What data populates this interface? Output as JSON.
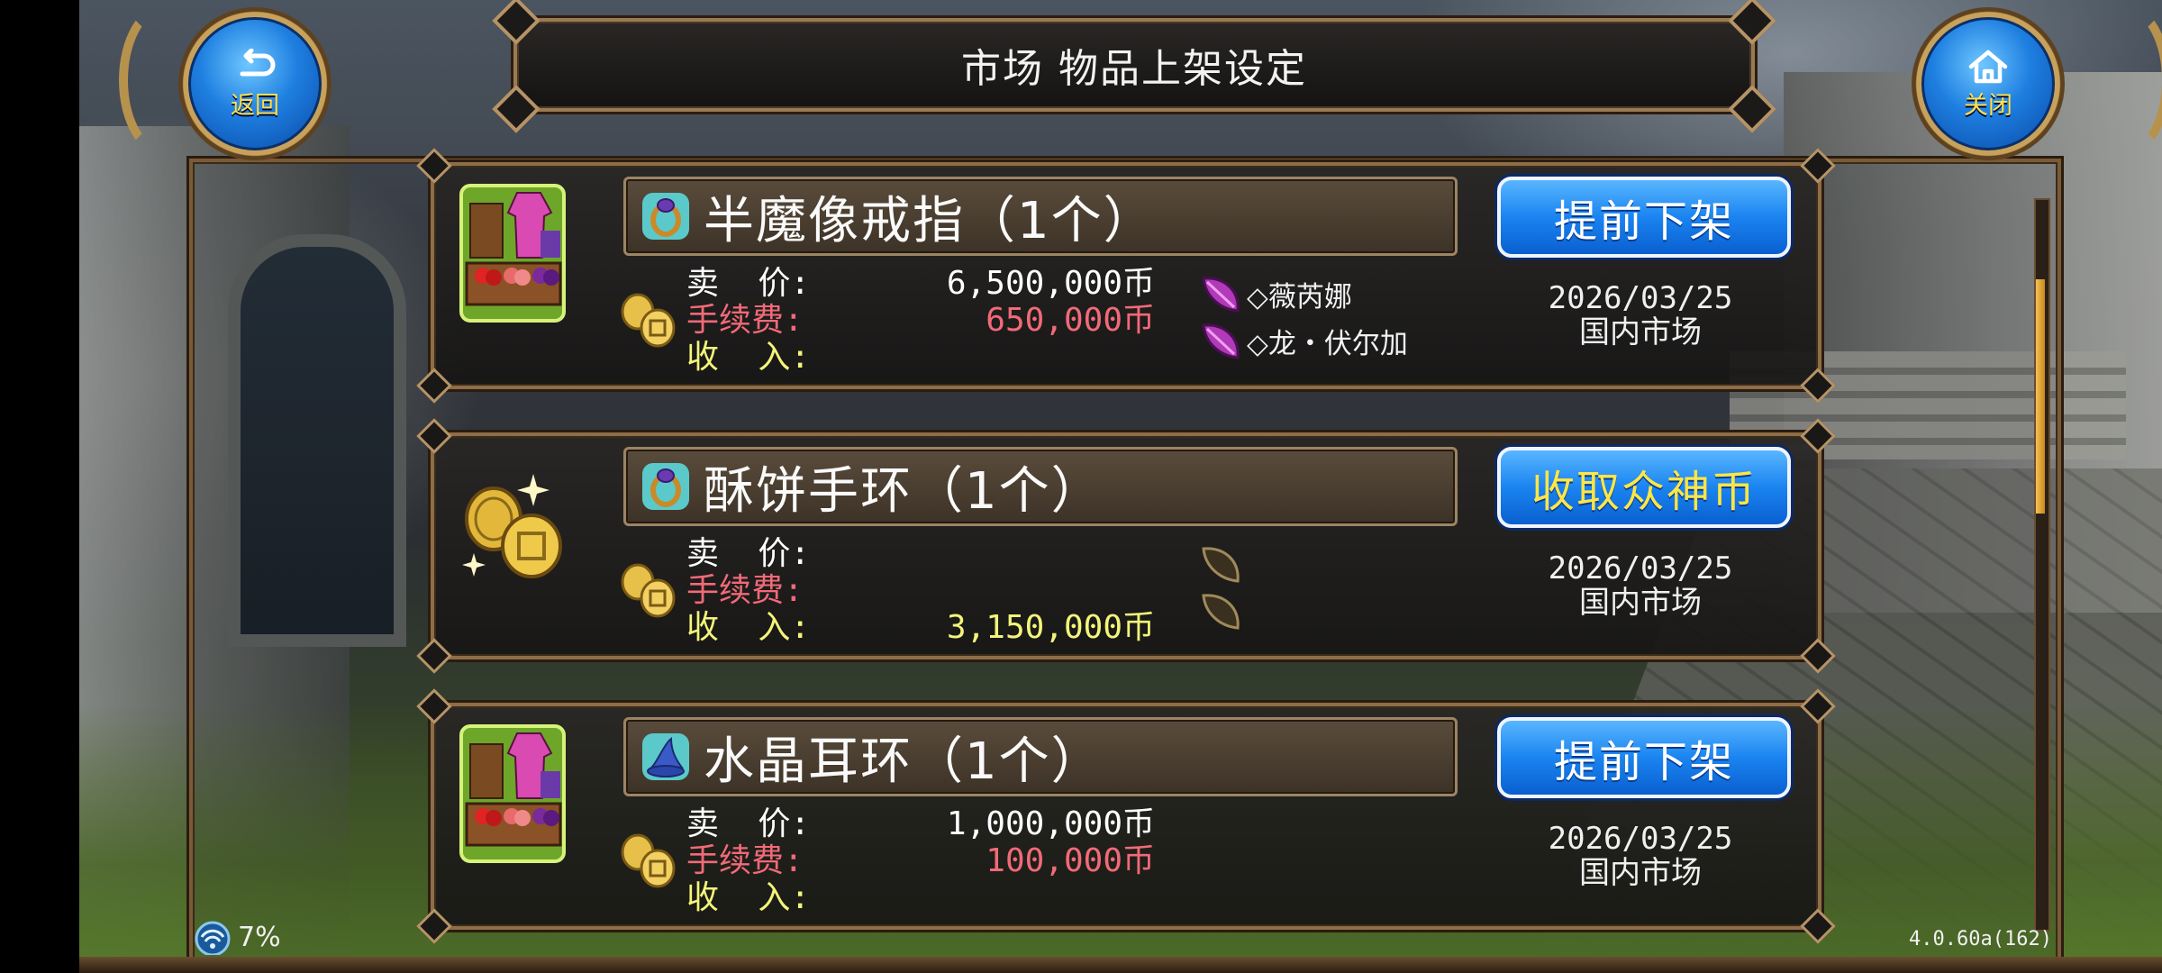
{
  "header": {
    "title": "市场 物品上架设定",
    "back_label": "返回",
    "close_label": "关闭",
    "back_icon": "return-arrow-icon",
    "close_icon": "home-icon"
  },
  "labels": {
    "sell_price": "卖  价:",
    "fee": "手续费:",
    "income": "收  入:"
  },
  "listings": [
    {
      "status": "on-sale",
      "status_icon": "market-stall-icon",
      "item_icon": "ring-icon",
      "name": "半魔像戒指（1个）",
      "action": "提前下架",
      "sell_price": "6,500,000币",
      "fee": "650,000币",
      "income": "",
      "buyers": [
        {
          "mark": "purple-leaf-icon",
          "text": "◇薇芮娜"
        },
        {
          "mark": "purple-leaf-icon",
          "text": "◇龙・伏尔加"
        }
      ],
      "date": "2026/03/25",
      "market": "国内市场"
    },
    {
      "status": "sold",
      "status_icon": "gold-coins-icon",
      "item_icon": "bracelet-icon",
      "name": "酥饼手环（1个）",
      "action": "收取众神币",
      "sell_price": "",
      "fee": "",
      "income": "3,150,000币",
      "buyers": [
        {
          "mark": "empty-leaf-icon",
          "text": ""
        },
        {
          "mark": "empty-leaf-icon",
          "text": ""
        }
      ],
      "date": "2026/03/25",
      "market": "国内市场"
    },
    {
      "status": "on-sale",
      "status_icon": "market-stall-icon",
      "item_icon": "wizard-hat-icon",
      "name": "水晶耳环（1个）",
      "action": "提前下架",
      "sell_price": "1,000,000币",
      "fee": "100,000币",
      "income": "",
      "buyers": [],
      "date": "2026/03/25",
      "market": "国内市场"
    }
  ],
  "footer": {
    "signal_percent": "7%",
    "version": "4.0.60a(162)"
  },
  "colors": {
    "button_blue": "#1a84f0",
    "button_gold_text": "#ffe646",
    "fee_red": "#f26a78",
    "income_yellow": "#f4f47a",
    "frame_bronze": "#8e6e48"
  }
}
